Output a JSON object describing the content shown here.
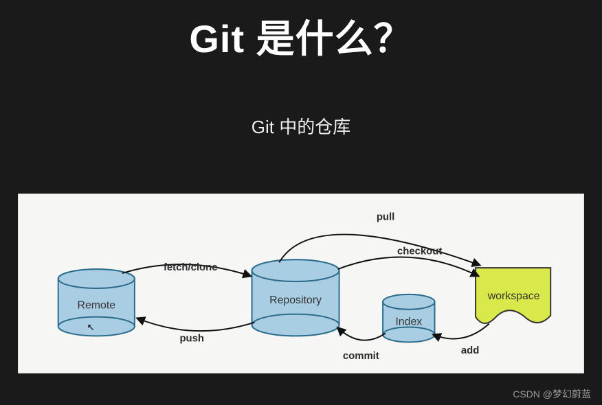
{
  "title": "Git 是什么？",
  "subtitle": "Git 中的仓库",
  "nodes": {
    "remote": "Remote",
    "repository": "Repository",
    "index": "Index",
    "workspace": "workspace"
  },
  "arrows": {
    "pull": "pull",
    "checkout": "checkout",
    "fetch_clone": "fetch/clone",
    "push": "push",
    "commit": "commit",
    "add": "add"
  },
  "watermark": "CSDN @梦幻蔚蓝",
  "faint_line": "",
  "colors": {
    "cylinder_fill": "#a9cde2",
    "cylinder_stroke": "#2b6b8c",
    "workspace_fill": "#d9e84a",
    "workspace_stroke": "#333",
    "arrow": "#111"
  }
}
